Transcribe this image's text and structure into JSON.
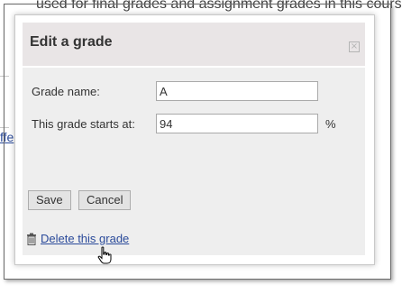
{
  "background": {
    "top_text": "used for final grades and assignment grades in this course.",
    "left_link_fragment": "ffe"
  },
  "dialog": {
    "title": "Edit a grade",
    "close_icon": "close-icon",
    "fields": {
      "grade_name_label": "Grade name:",
      "grade_name_value": "A",
      "starts_at_label": "This grade starts at:",
      "starts_at_value": "94",
      "percent_suffix": "%"
    },
    "buttons": {
      "save_label": "Save",
      "cancel_label": "Cancel"
    },
    "delete": {
      "icon": "trash-icon",
      "link_text": "Delete this grade"
    }
  },
  "colors": {
    "titlebar_bg": "#e9e5e6",
    "body_bg": "#eeeeee",
    "link": "#2a4a9a"
  }
}
